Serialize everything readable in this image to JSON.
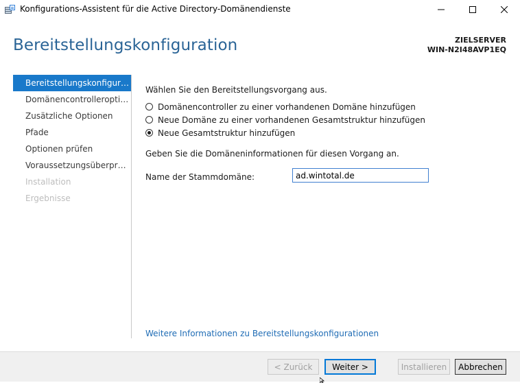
{
  "window": {
    "title": "Konfigurations-Assistent für die Active Directory-Domänendienste",
    "app_icon": "server-manager-icon",
    "controls": [
      "minimize-icon",
      "maximize-icon",
      "close-icon"
    ]
  },
  "header": {
    "page_title": "Bereitstellungskonfiguration",
    "target_label": "ZIELSERVER",
    "target_server": "WIN-N2I48AVP1EQ"
  },
  "sidebar": {
    "items": [
      {
        "label": "Bereitstellungskonfigurati...",
        "state": "active"
      },
      {
        "label": "Domänencontrolleroption...",
        "state": "normal"
      },
      {
        "label": "Zusätzliche Optionen",
        "state": "normal"
      },
      {
        "label": "Pfade",
        "state": "normal"
      },
      {
        "label": "Optionen prüfen",
        "state": "normal"
      },
      {
        "label": "Voraussetzungsüberprüfu...",
        "state": "normal"
      },
      {
        "label": "Installation",
        "state": "disabled"
      },
      {
        "label": "Ergebnisse",
        "state": "disabled"
      }
    ]
  },
  "main": {
    "operation_prompt": "Wählen Sie den Bereitstellungsvorgang aus.",
    "options": [
      {
        "label": "Domänencontroller zu einer vorhandenen Domäne hinzufügen",
        "checked": false
      },
      {
        "label": "Neue Domäne zu einer vorhandenen Gesamtstruktur hinzufügen",
        "checked": false
      },
      {
        "label": "Neue Gesamtstruktur hinzufügen",
        "checked": true
      }
    ],
    "domain_prompt": "Geben Sie die Domäneninformationen für diesen Vorgang an.",
    "root_domain_label": "Name der Stammdomäne:",
    "root_domain_value": "ad.wintotal.de",
    "help_link": "Weitere Informationen zu Bereitstellungskonfigurationen"
  },
  "footer": {
    "back": "< Zurück",
    "next": "Weiter >",
    "install": "Installieren",
    "cancel": "Abbrechen"
  },
  "colors": {
    "accent": "#1979ca",
    "title_blue": "#2a6496",
    "link": "#1f6cb5",
    "footer_bg": "#f0f0f0"
  }
}
